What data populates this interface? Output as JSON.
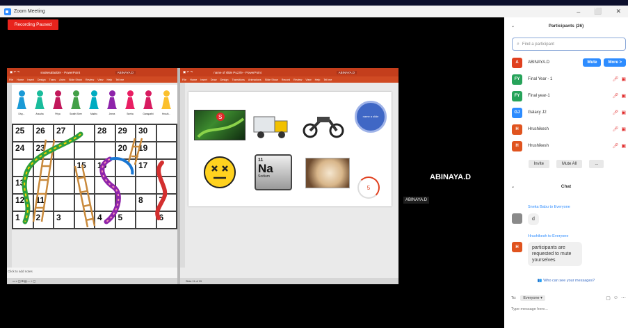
{
  "window": {
    "title": "Zoom Meeting",
    "controls": [
      "–",
      "⬜",
      "✕"
    ]
  },
  "recording": {
    "label": "Recording Paused"
  },
  "share": {
    "left_doc": {
      "ribbon_title": "snakes&ladder - PowerPoint",
      "user": "ABINAYA.D",
      "menu": [
        "File",
        "Home",
        "Insert",
        "Design",
        "Trans",
        "Anim",
        "Slide Show",
        "Review",
        "View",
        "Help",
        "Tell me"
      ],
      "status": "Click to add notes",
      "notes_placeholder": "Click to add notes"
    },
    "right_doc": {
      "ribbon_title": "name of slide Puzzle - PowerPoint",
      "user": "ABINAYA.D",
      "menu": [
        "File",
        "Home",
        "Insert",
        "Draw",
        "Design",
        "Transitions",
        "Animations",
        "Slide Show",
        "Record",
        "Review",
        "View",
        "Help",
        "Tell me"
      ],
      "status": "Slide 11 of 19"
    },
    "pieces": [
      {
        "color": "#1a9ad6",
        "label": "Divy..."
      },
      {
        "color": "#1abc9c",
        "label": "Anusha"
      },
      {
        "color": "#c2185b",
        "label": "Priya"
      },
      {
        "color": "#43a047",
        "label": "Swathi Sree"
      },
      {
        "color": "#00acc1",
        "label": "Madhu"
      },
      {
        "color": "#8e24aa",
        "label": "Jeeva"
      },
      {
        "color": "#e91e63",
        "label": "Sneha"
      },
      {
        "color": "#d81b60",
        "label": "Ganapathi"
      },
      {
        "color": "#fbc02d",
        "label": "Hrushi..."
      }
    ],
    "board_numbers": [
      [
        "25",
        "26",
        "27",
        "",
        "28",
        "29",
        "30",
        ""
      ],
      [
        "24",
        "23",
        "",
        "",
        "",
        "20",
        "19",
        ""
      ],
      [
        "",
        "",
        "",
        "15",
        "16",
        "",
        "17",
        ""
      ],
      [
        "13",
        "",
        "",
        "",
        "",
        "",
        "",
        ""
      ],
      [
        "12",
        "11",
        "",
        "",
        "",
        "",
        "8",
        "7"
      ],
      [
        "1",
        "2",
        "3",
        "",
        "4",
        "5",
        "",
        "6"
      ]
    ],
    "slide_badge": "name a slide",
    "timer_value": "5",
    "element_symbol": "Na",
    "element_number": "11",
    "element_name": "Sodium"
  },
  "video": {
    "name_label": "ABINAYA.D",
    "name_tag": "ABINAYA.D"
  },
  "participants": {
    "header": "Participants (26)",
    "search_placeholder": "Find a participant",
    "mute_label": "Mute",
    "more_label": "More >",
    "list": [
      {
        "initials": "A",
        "name": "ABINAYA.D",
        "color": "#e0401f"
      },
      {
        "initials": "FY",
        "name": "Final Year - 1",
        "color": "#27a35a"
      },
      {
        "initials": "FY",
        "name": "Final year-1",
        "color": "#27a35a"
      },
      {
        "initials": "GJ",
        "name": "Galaxy J2",
        "color": "#2d8cff"
      },
      {
        "initials": "H",
        "name": "Hrushikesh",
        "color": "#e0541f"
      },
      {
        "initials": "H",
        "name": "Hrushikesh",
        "color": "#e0541f"
      }
    ],
    "invite_label": "Invite",
    "mute_all_label": "Mute All",
    "more_dots": "..."
  },
  "chat": {
    "header": "Chat",
    "messages": [
      {
        "from": "Sneka Babu to Everyone",
        "text": "d",
        "avatar_color": "#8a8a8a"
      },
      {
        "from": "Hrushikesh to Everyone",
        "text": "participants are requested to mute yourselves",
        "avatar_color": "#e0541f",
        "initials": "H"
      }
    ],
    "who_sees": "Who can see your messages?",
    "to_label": "To:",
    "to_value": "Everyone ▾",
    "input_placeholder": "Type message here..."
  },
  "colors": {
    "accent": "#2d8cff",
    "record": "#e8231c",
    "ppt": "#c43e1c"
  }
}
